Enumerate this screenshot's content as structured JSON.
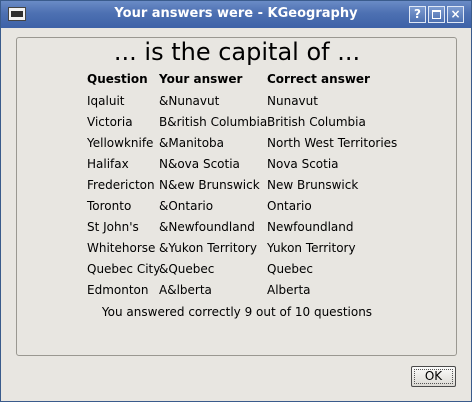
{
  "window": {
    "title": "Your answers were - KGeography"
  },
  "titlebar": {
    "help_label": "?",
    "close_label": "×"
  },
  "heading": "... is the capital of ...",
  "columns": {
    "question": "Question",
    "your_answer": "Your answer",
    "correct_answer": "Correct answer"
  },
  "rows": [
    {
      "question": "Iqaluit",
      "your_answer": "&Nunavut",
      "correct_answer": "Nunavut"
    },
    {
      "question": "Victoria",
      "your_answer": "B&ritish Columbia",
      "correct_answer": "British Columbia"
    },
    {
      "question": "Yellowknife",
      "your_answer": "&Manitoba",
      "correct_answer": "North West Territories"
    },
    {
      "question": "Halifax",
      "your_answer": "N&ova Scotia",
      "correct_answer": "Nova Scotia"
    },
    {
      "question": "Fredericton",
      "your_answer": "N&ew Brunswick",
      "correct_answer": "New Brunswick"
    },
    {
      "question": "Toronto",
      "your_answer": "&Ontario",
      "correct_answer": "Ontario"
    },
    {
      "question": "St John's",
      "your_answer": "&Newfoundland",
      "correct_answer": "Newfoundland"
    },
    {
      "question": "Whitehorse",
      "your_answer": "&Yukon Territory",
      "correct_answer": "Yukon Territory"
    },
    {
      "question": "Quebec City",
      "your_answer": "&Quebec",
      "correct_answer": "Quebec"
    },
    {
      "question": "Edmonton",
      "your_answer": "A&lberta",
      "correct_answer": "Alberta"
    }
  ],
  "summary": "You answered correctly 9 out of 10 questions",
  "ok_button": {
    "label": "OK"
  }
}
